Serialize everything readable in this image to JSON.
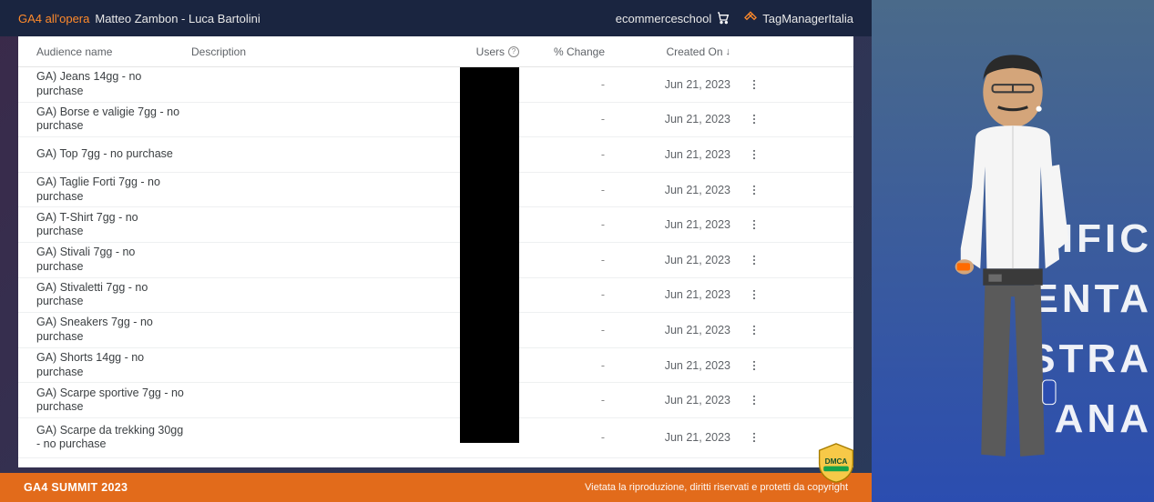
{
  "header": {
    "title_highlight": "GA4 all'opera",
    "separator": " - ",
    "authors": "Matteo Zambon - Luca Bartolini",
    "logo1_text": "ecommerceschool",
    "logo2_text": "TagManagerItalia"
  },
  "table": {
    "columns": {
      "name": "Audience name",
      "description": "Description",
      "users": "Users",
      "change": "% Change",
      "created": "Created On"
    },
    "rows": [
      {
        "name": "GA) Jeans 14gg - no purchase",
        "change": "-",
        "created": "Jun 21, 2023"
      },
      {
        "name": "GA) Borse e valigie 7gg - no purchase",
        "change": "-",
        "created": "Jun 21, 2023"
      },
      {
        "name": "GA) Top 7gg - no purchase",
        "change": "-",
        "created": "Jun 21, 2023"
      },
      {
        "name": "GA) Taglie Forti 7gg - no purchase",
        "change": "-",
        "created": "Jun 21, 2023"
      },
      {
        "name": "GA) T-Shirt 7gg - no purchase",
        "change": "-",
        "created": "Jun 21, 2023"
      },
      {
        "name": "GA) Stivali 7gg - no purchase",
        "change": "-",
        "created": "Jun 21, 2023"
      },
      {
        "name": "GA) Stivaletti 7gg - no purchase",
        "change": "-",
        "created": "Jun 21, 2023"
      },
      {
        "name": "GA) Sneakers 7gg - no purchase",
        "change": "-",
        "created": "Jun 21, 2023"
      },
      {
        "name": "GA) Shorts 14gg - no purchase",
        "change": "-",
        "created": "Jun 21, 2023"
      },
      {
        "name": "GA) Scarpe sportive 7gg - no purchase",
        "change": "-",
        "created": "Jun 21, 2023"
      },
      {
        "name": "GA) Scarpe da trekking 30gg - no purchase",
        "change": "-",
        "created": "Jun 21, 2023"
      }
    ]
  },
  "footer": {
    "event": "GA4 SUMMIT 2023",
    "copyright": "Vietata la riproduzione, diritti riservati e protetti da copyright"
  },
  "backdrop": {
    "lines": [
      "IFIC",
      "ENTA",
      "STRA",
      "ANA"
    ]
  }
}
